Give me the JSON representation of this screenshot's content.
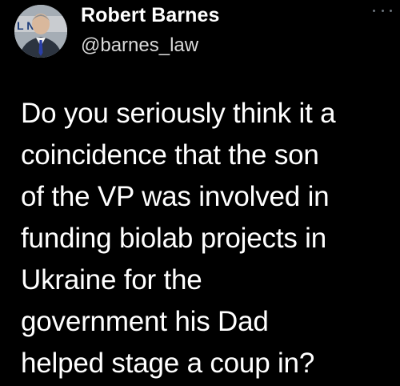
{
  "author": {
    "display_name": "Robert Barnes",
    "handle": "@barnes_law",
    "avatar_icon": "profile-photo",
    "avatar_text": "L  NOI"
  },
  "menu": {
    "icon": "more-options-icon"
  },
  "tweet": {
    "lines": [
      "Do you seriously think it a",
      "coincidence that the son",
      "of the VP was involved in",
      "funding biolab projects in",
      "Ukraine for the",
      "government his Dad",
      "helped stage a coup in?"
    ]
  },
  "colors": {
    "background": "#000000",
    "text": "#ffffff",
    "handle": "#d9d9d9",
    "muted": "#6e767d"
  }
}
